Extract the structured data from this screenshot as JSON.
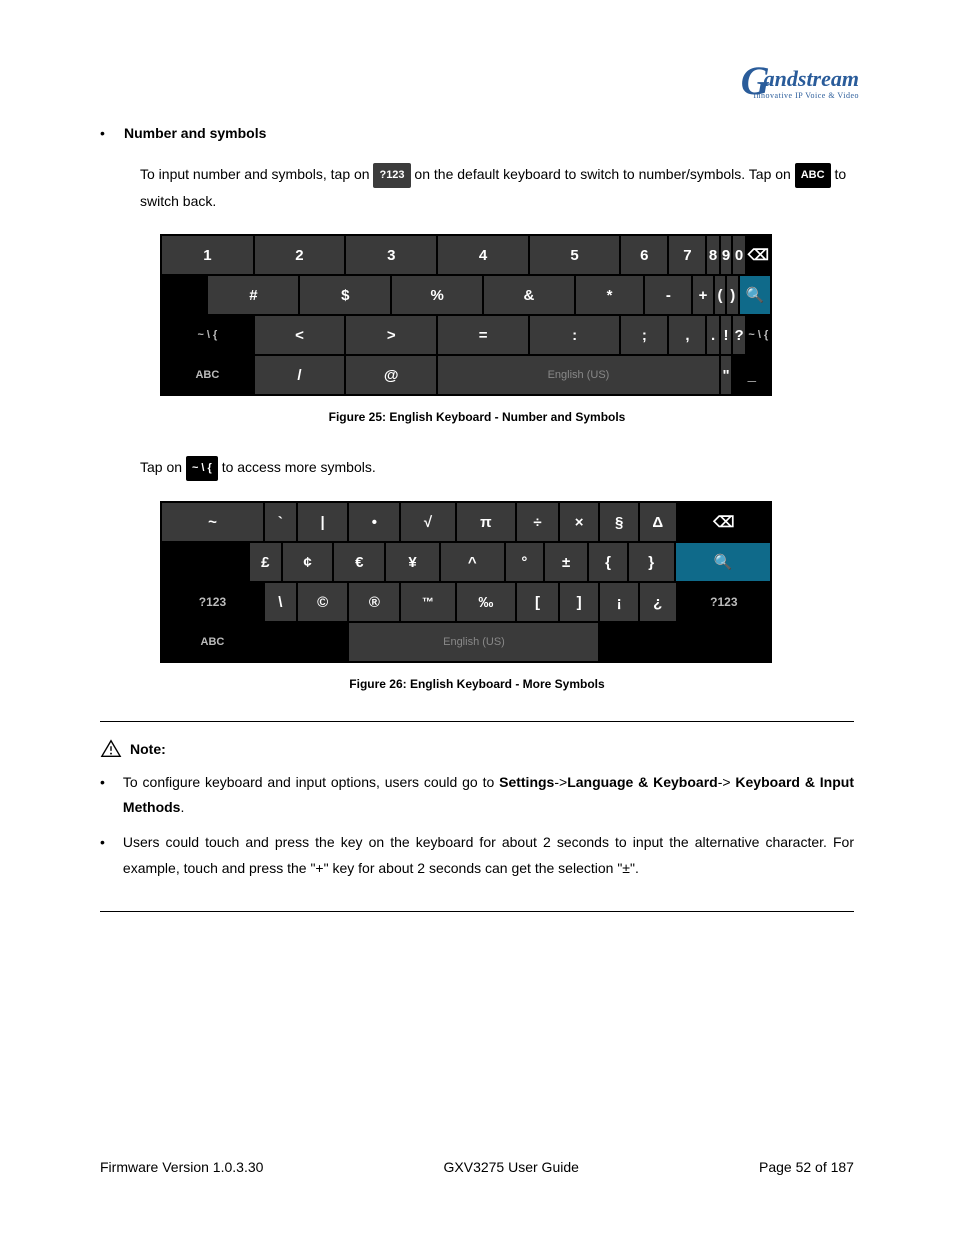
{
  "logo": {
    "brand": "andstream",
    "tagline": "Innovative IP Voice & Video"
  },
  "heading": "Number and symbols",
  "para1_a": "To input number and symbols, tap on ",
  "key_123": "?123",
  "para1_b": " on the default keyboard to switch to number/symbols. Tap on ",
  "key_abc": "ABC",
  "para1_c": " to switch back.",
  "kbd1": {
    "r1": [
      "1",
      "2",
      "3",
      "4",
      "5",
      "6",
      "7",
      "8",
      "9",
      "0",
      "⌫"
    ],
    "r2": [
      "#",
      "$",
      "%",
      "&",
      "*",
      "-",
      "+",
      "(",
      ")",
      "🔍"
    ],
    "r3": [
      "~ \\ {",
      "<",
      ">",
      "=",
      ":",
      ";",
      ",",
      ".",
      "!",
      "?",
      "~ \\ {"
    ],
    "r4_abc": "ABC",
    "r4_slash": "/",
    "r4_at": "@",
    "r4_space": "English (US)",
    "r4_quote": "\"",
    "r4_under": "_"
  },
  "caption1": "Figure 25: English Keyboard - Number and Symbols",
  "para2_a": "Tap on ",
  "key_sym": "~ \\ {",
  "para2_b": " to access more symbols.",
  "kbd2": {
    "r1": [
      "~",
      "`",
      "|",
      "•",
      "√",
      "π",
      "÷",
      "×",
      "§",
      "Δ",
      "⌫"
    ],
    "r2": [
      "£",
      "¢",
      "€",
      "¥",
      "^",
      "°",
      "±",
      "{",
      "}",
      "🔍"
    ],
    "r3": [
      "?123",
      "\\",
      "©",
      "®",
      "™",
      "‰",
      "[",
      "]",
      "¡",
      "¿",
      "?123"
    ],
    "r4_abc": "ABC",
    "r4_space": "English (US)"
  },
  "caption2": "Figure 26: English Keyboard - More Symbols",
  "note_label": "Note:",
  "note1_a": "To configure keyboard and input options, users could go to ",
  "note1_b": "Settings",
  "note1_c": "->",
  "note1_d": "Language & Keyboard",
  "note1_e": "-> ",
  "note1_f": "Keyboard & Input Methods",
  "note1_g": ".",
  "note2": "Users could touch and press the key on the keyboard for about 2 seconds to input the alternative character. For example, touch and press the \"+\" key for about 2 seconds can get the selection \"±\".",
  "footer": {
    "left": "Firmware Version 1.0.3.30",
    "center": "GXV3275 User Guide",
    "right": "Page 52 of 187"
  }
}
